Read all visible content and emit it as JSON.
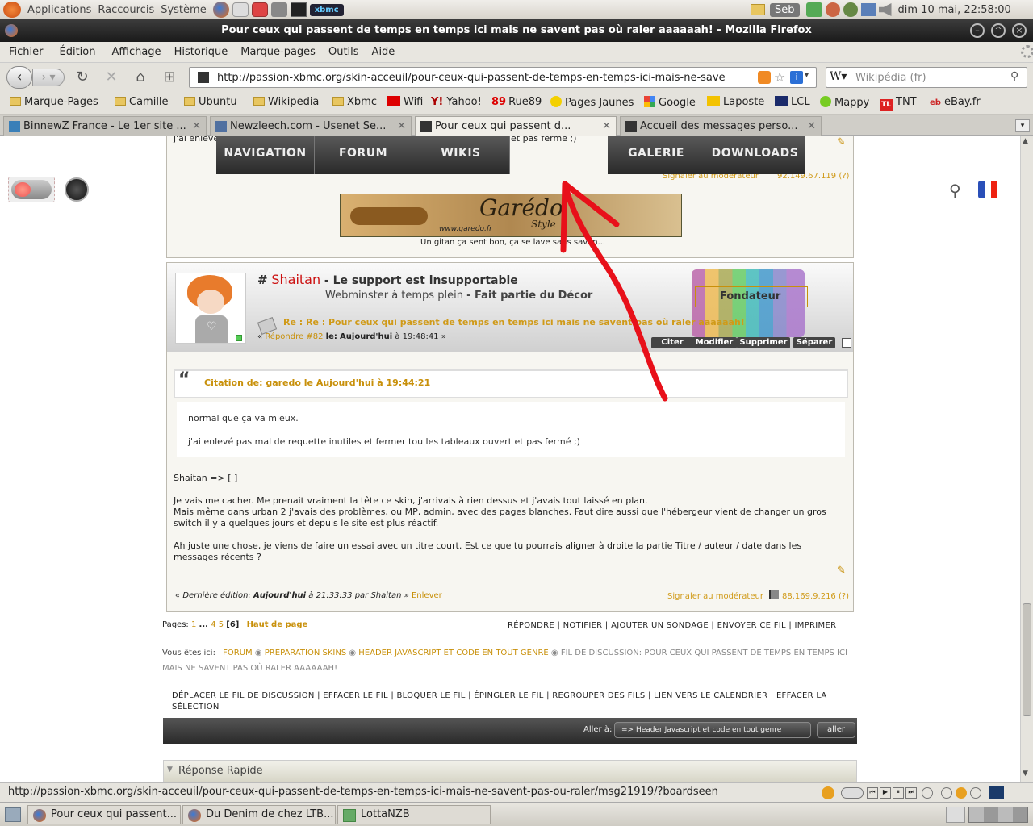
{
  "gnome_panel": {
    "applications": "Applications",
    "raccourcis": "Raccourcis",
    "systeme": "Système",
    "xbmc_label": "xbmc",
    "user": "Seb",
    "datetime": "dim 10 mai, 22:58:00"
  },
  "window": {
    "title": "Pour ceux qui passent de temps en temps ici mais ne savent pas où raler aaaaaah! - Mozilla Firefox"
  },
  "menubar": [
    "Fichier",
    "Édition",
    "Affichage",
    "Historique",
    "Marque-pages",
    "Outils",
    "Aide"
  ],
  "navbar": {
    "url": "http://passion-xbmc.org/skin-acceuil/pour-ceux-qui-passent-de-temps-en-temps-ici-mais-ne-savent-pas",
    "search_placeholder": "Wikipédia (fr)"
  },
  "bookmarks": [
    "Marque-Pages",
    "Camille",
    "Ubuntu",
    "Wikipedia",
    "Xbmc",
    "Wifi",
    "Yahoo!",
    "Rue89",
    "Pages Jaunes",
    "Google",
    "Laposte",
    "LCL",
    "Mappy",
    "TNT",
    "eBay.fr"
  ],
  "tabs": [
    {
      "label": "BinnewZ France - Le 1er site ..."
    },
    {
      "label": "Newzleech.com - Usenet Se..."
    },
    {
      "label": "Pour ceux qui passent d..."
    },
    {
      "label": "Accueil des messages perso..."
    }
  ],
  "site_nav": [
    "NAVIGATION",
    "FORUM",
    "WIKIS",
    "GALERIE",
    "DOWNLOADS"
  ],
  "prev_post": {
    "fragment_left": "j'ai enlevé",
    "fragment_right": "et pas fermé ;)",
    "report": "Signaler au modérateur",
    "ip": "92.149.67.119 (?)",
    "signature_caption": "Un gitan ça  sent bon, ça se lave sans savon...",
    "banner_text": "Garédo",
    "banner_sub": "Style",
    "banner_url": "www.garedo.fr"
  },
  "post": {
    "hash": "#",
    "author": "Shaitan",
    "author_title": "- Le support est insupportable",
    "rank": "Webminster à temps plein",
    "rank2": "- Fait partie du Décor",
    "badge": "Fondateur",
    "subject": "Re : Re : Pour ceux qui passent de temps en temps ici mais ne savent pas où raler aaaaaah!",
    "reply_prefix": "«",
    "reply_link": "Répondre #82",
    "reply_date_label": "le:",
    "reply_date_bold": "Aujourd'hui",
    "reply_time": "à 19:48:41 »",
    "buttons": [
      "Citer",
      "Modifier",
      "Supprimer",
      "Séparer"
    ],
    "quote_header": "Citation de: garedo le Aujourd'hui à 19:44:21",
    "quote_lines": [
      "normal que ça va mieux.",
      "j'ai enlevé pas mal de requette inutiles et fermer tou les tableaux ouvert et pas fermé ;)"
    ],
    "body": [
      "Shaitan => [ ]",
      "Je vais me cacher. Me prenait vraiment la tête ce skin, j'arrivais à rien dessus et j'avais tout laissé en plan.",
      "Mais même dans urban 2 j'avais des problèmes, ou MP, admin, avec des pages blanches. Faut dire aussi que l'hébergeur vient de changer un gros switch il y a quelques jours et depuis le site est plus réactif.",
      "Ah juste une chose, je viens de faire un essai avec un titre court. Est ce que tu pourrais aligner à droite la partie Titre / auteur / date dans les messages récents ?"
    ],
    "last_edit_prefix": "« Dernière édition:",
    "last_edit_bold": "Aujourd'hui",
    "last_edit_rest": "à 21:33:33 par Shaitan »",
    "remove": "Enlever",
    "report": "Signaler au modérateur",
    "ip": "88.169.9.216 (?)"
  },
  "pagination": {
    "label": "Pages:",
    "p1": "1",
    "dots": "...",
    "p4": "4",
    "p5": "5",
    "current": "[6]",
    "top": "Haut de page"
  },
  "thread_actions": [
    "RÉPONDRE",
    "NOTIFIER",
    "AJOUTER UN SONDAGE",
    "ENVOYER CE FIL",
    "IMPRIMER"
  ],
  "breadcrumb": {
    "label": "Vous êtes ici:",
    "items": [
      "FORUM",
      "PREPARATION SKINS",
      "HEADER JAVASCRIPT ET CODE EN TOUT GENRE"
    ],
    "current": "FIL DE DISCUSSION: POUR CEUX QUI PASSENT DE TEMPS EN TEMPS ICI MAIS NE SAVENT PAS OÙ RALER AAAAAAH!"
  },
  "mod_actions": [
    "DÉPLACER LE FIL DE DISCUSSION",
    "EFFACER LE FIL",
    "BLOQUER LE FIL",
    "ÉPINGLER LE FIL",
    "REGROUPER DES FILS",
    "LIEN VERS LE CALENDRIER",
    "EFFACER LA SÉLECTION"
  ],
  "jump": {
    "label": "Aller à:",
    "selected": "=> Header Javascript et code en tout genre",
    "go": "aller"
  },
  "quick_reply": "Réponse Rapide",
  "status_url": "http://passion-xbmc.org/skin-acceuil/pour-ceux-qui-passent-de-temps-en-temps-ici-mais-ne-savent-pas-ou-raler/msg21919/?boardseen",
  "taskbar": [
    "Pour ceux qui passent...",
    "Du Denim de chez LTB...",
    "LottaNZB"
  ],
  "colors": {
    "accent_gold": "#c8900a",
    "author_red": "#cc1111",
    "annotation_red": "#e8101a"
  }
}
